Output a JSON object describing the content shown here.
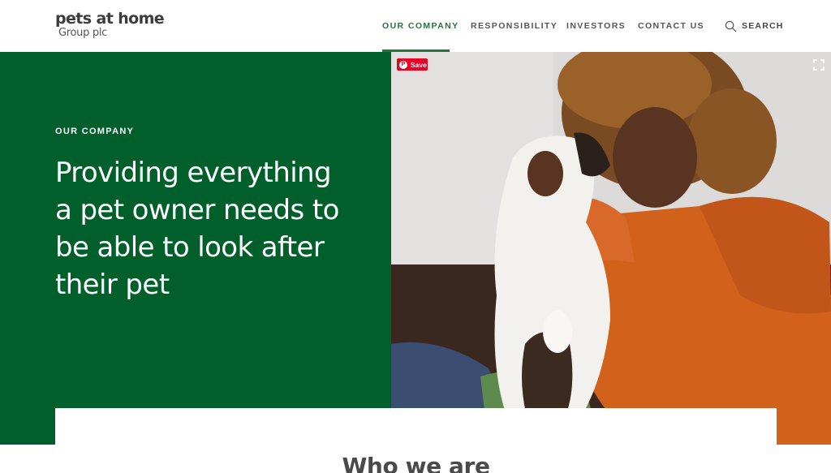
{
  "logo": {
    "main": "pets at home",
    "sub": "Group plc"
  },
  "nav": {
    "items": [
      {
        "label": "OUR COMPANY",
        "active": true
      },
      {
        "label": "RESPONSIBILITY",
        "active": false
      },
      {
        "label": "INVESTORS",
        "active": false
      },
      {
        "label": "CONTACT US",
        "active": false
      }
    ],
    "search_label": "SEARCH"
  },
  "hero": {
    "eyebrow": "OUR COMPANY",
    "headline": "Providing everything a pet owner needs to be able to look after their pet",
    "save_label": "Save",
    "icons": [
      "pinterest-icon",
      "fullscreen-icon"
    ]
  },
  "section": {
    "title": "Who we are"
  },
  "colors": {
    "brand_green": "#005f2a",
    "nav_active": "#2f6e41",
    "pinterest_red": "#e60023",
    "sweater_orange": "#d2611c"
  }
}
